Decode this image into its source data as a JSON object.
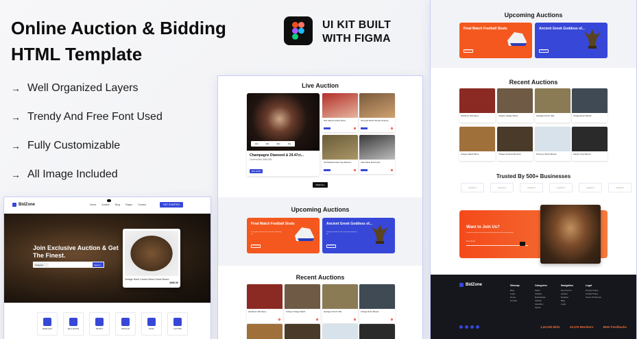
{
  "headline": "Online Auction & Bidding HTML Template",
  "kit": {
    "line1": "UI KIT BUILT",
    "line2": "WITH FIGMA"
  },
  "features": [
    "Well Organized Layers",
    "Trendy And Free Font Used",
    "Fully Customizable",
    "All Image Included"
  ],
  "arrow_glyph": "→",
  "colors": {
    "accent": "#3747d8",
    "orange": "#f4581f",
    "dark": "#15171c"
  },
  "hero_mock": {
    "logo": "BidZone",
    "nav": [
      "Home",
      "Auction",
      "Blog",
      "Pages",
      "Contact"
    ],
    "nav_button": "GET STARTED",
    "title": "Join Exclusive Auction & Get The Finest.",
    "search_select": "Category",
    "search_placeholder": "Search",
    "search_button": "Search",
    "photo_caption": "Vintage Hand Carved Wood Game Board",
    "photo_price": "$450.00",
    "categories": [
      "JEWELLERY",
      "REAL ESTATE",
      "SPORTS",
      "VEHICLES",
      "MUSIC",
      "CLOTHES"
    ]
  },
  "mid_mock": {
    "live_title": "Live Auction",
    "main_card": {
      "title": "Champagne Diamond & 29.47ct...",
      "sub": "Current Bid: $99,005",
      "timer": [
        "10d",
        "10h",
        "40m",
        "10s"
      ],
      "button": "BID NOW"
    },
    "small_cards": [
      {
        "title": "Red Glamour Party Dress",
        "color_a": "#b3302b",
        "color_b": "#e6b59f"
      },
      {
        "title": "Old Light Wood Wooden Frames",
        "color_a": "#7a5b3c",
        "color_b": "#cfa170"
      },
      {
        "title": "Old Mediterranean Sea Mansion",
        "color_a": "#6b5c3a",
        "color_b": "#a89665"
      },
      {
        "title": "Cafe Racer Motorcycle",
        "color_a": "#3a3a3a",
        "color_b": "#bdbdbd"
      }
    ],
    "view_all": "VIEW ALL",
    "upcoming_title": "Upcoming Auctions",
    "promos": [
      {
        "title": "Final Match Football Studs",
        "desc": "Lorem ipsum dolor sit amet consectetur adipiscing elit",
        "button": "BID NOW",
        "bg": "#f4581f"
      },
      {
        "title": "Ancient Greek Goddess of...",
        "desc": "Lorem ipsum dolor sit amet consectetur adipiscing elit",
        "button": "BID NOW",
        "bg": "#3747d8"
      }
    ],
    "recent_title": "Recent Auctions",
    "recent": [
      {
        "title": "Handloom Silk Saree",
        "color": "#8a2a22"
      },
      {
        "title": "Antique Vintage Watch",
        "color": "#6e5a45"
      },
      {
        "title": "Heritage French Villa",
        "color": "#8a7b55"
      },
      {
        "title": "Vintage Retro Bicycle",
        "color": "#3f4a55"
      }
    ]
  },
  "right_mock": {
    "upcoming_title": "Upcoming Auctions",
    "promos": [
      {
        "title": "Final Match Football Studs",
        "button": "BID NOW",
        "bg": "#f4581f"
      },
      {
        "title": "Ancient Greek Goddess of...",
        "button": "BID NOW",
        "bg": "#3747d8"
      }
    ],
    "recent_title": "Recent Auctions",
    "recent": [
      {
        "title": "Handloom Silk Saree",
        "color": "#8a2a22"
      },
      {
        "title": "Antique Vintage Watch",
        "color": "#6e5a45"
      },
      {
        "title": "Heritage French Villa",
        "color": "#8a7b55"
      },
      {
        "title": "Vintage Retro Bicycle",
        "color": "#3f4a55"
      },
      {
        "title": "Antique Gilded Mirror",
        "color": "#a0703b"
      },
      {
        "title": "Vintage Ornamental Clock",
        "color": "#4a3a2a"
      },
      {
        "title": "Premium Sports Bicycle",
        "color": "#d7e2ea"
      },
      {
        "title": "Classic Vinyl Record",
        "color": "#2a2a2a"
      }
    ],
    "trusted_title": "Trusted By 500+ Businesses",
    "businesses": [
      "Logoipsum",
      "Logoipsum",
      "Logoipsum",
      "Logoipsum",
      "Logoipsum",
      "Logoipsum"
    ],
    "join_title": "Want to Join Us?",
    "join_desc": "Lorem ipsum dolor sit amet consectetur adipiscing elit sed do eiusmod tempor",
    "join_placeholder": "Enter Email",
    "footer": {
      "logo": "BidZone",
      "columns": [
        {
          "head": "Sitemap",
          "items": [
            "Blog",
            "Login",
            "Home",
            "Contact"
          ]
        },
        {
          "head": "Categories",
          "items": [
            "Music",
            "Clothes",
            "Real Estate",
            "Vehicle",
            "Jewellery",
            "Sports"
          ]
        },
        {
          "head": "Navigation",
          "items": [
            "My Account",
            "Auction",
            "Register",
            "Blog",
            "Login"
          ]
        },
        {
          "head": "Legal",
          "items": [
            "Privacy Policy",
            "Cookie Policy",
            "Terms Of Service"
          ]
        }
      ],
      "stats": [
        "1,50,000 Bids",
        "15,376 Members",
        "8942 Feedbacks"
      ]
    }
  }
}
